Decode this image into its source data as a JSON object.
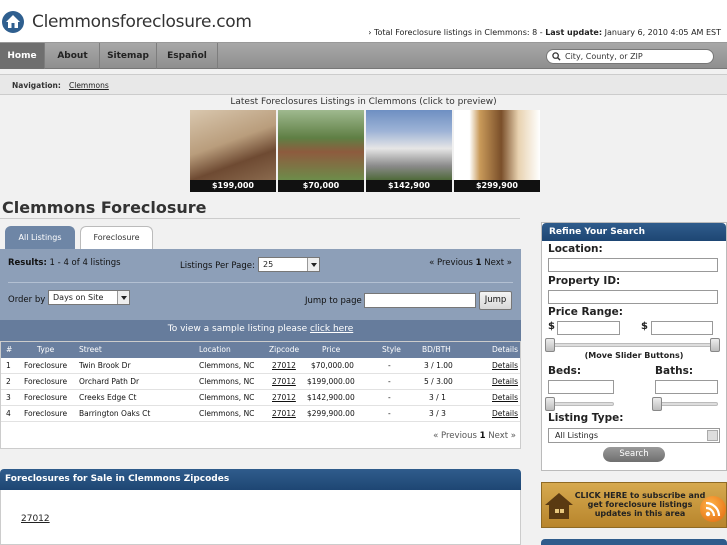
{
  "header": {
    "site_title": "Clemmonsforeclosure.com",
    "status_prefix": "› Total Foreclosure listings in Clemmons: 8 - ",
    "update_label": "Last update:",
    "update_value": " January 6, 2010 4:05 AM EST"
  },
  "nav": {
    "items": [
      {
        "label": "Home",
        "active": true
      },
      {
        "label": "About"
      },
      {
        "label": "Sitemap"
      },
      {
        "label": "Español"
      }
    ],
    "search_placeholder": "City, County, or ZIP"
  },
  "breadcrumb": {
    "label": "Navigation:",
    "link": "Clemmons"
  },
  "latest": {
    "title": "Latest Foreclosures Listings in Clemmons (click to preview)",
    "thumbs": [
      {
        "price": "$199,000"
      },
      {
        "price": "$70,000"
      },
      {
        "price": "$142,900"
      },
      {
        "price": "$299,900"
      }
    ]
  },
  "main": {
    "heading": "Clemmons Foreclosure",
    "tabs": [
      {
        "label": "All Listings",
        "active": true
      },
      {
        "label": "Foreclosure"
      }
    ],
    "results_label": "Results:",
    "results_value": " 1 - 4 of 4 listings",
    "lpp_label": "Listings Per Page:",
    "lpp_value": "25",
    "pager_prev": "« Previous",
    "pager_page": "1",
    "pager_next": "Next »",
    "orderby_label": "Order by",
    "orderby_value": "Days on Site",
    "jump_label": "Jump to page",
    "jump_button": "Jump",
    "sample_text": "To view a sample listing please ",
    "sample_link": "click here"
  },
  "table": {
    "headers": [
      "#",
      "Type",
      "Street",
      "Location",
      "Zipcode",
      "Price",
      "Style",
      "BD/BTH",
      "Details"
    ],
    "rows": [
      [
        "1",
        "Foreclosure",
        "Twin Brook Dr",
        "Clemmons, NC",
        "27012",
        "$70,000.00",
        "-",
        "3 / 1.00",
        "Details"
      ],
      [
        "2",
        "Foreclosure",
        "Orchard Path Dr",
        "Clemmons, NC",
        "27012",
        "$199,000.00",
        "-",
        "5 / 3.00",
        "Details"
      ],
      [
        "3",
        "Foreclosure",
        "Creeks Edge Ct",
        "Clemmons, NC",
        "27012",
        "$142,900.00",
        "-",
        "3 / 1",
        "Details"
      ],
      [
        "4",
        "Foreclosure",
        "Barrington Oaks Ct",
        "Clemmons, NC",
        "27012",
        "$299,900.00",
        "-",
        "3 / 3",
        "Details"
      ]
    ]
  },
  "zipcodes": {
    "heading": "Foreclosures for Sale in Clemmons Zipcodes",
    "items": [
      "27012"
    ]
  },
  "refine": {
    "heading": "Refine Your Search",
    "location_label": "Location:",
    "property_id_label": "Property ID:",
    "price_range_label": "Price Range:",
    "dollar": "$",
    "slider_note": "(Move Slider Buttons)",
    "beds_label": "Beds:",
    "baths_label": "Baths:",
    "listing_type_label": "Listing Type:",
    "listing_type_value": "All Listings",
    "search_button": "Search"
  },
  "subscribe": {
    "text": "CLICK HERE to subscribe and get foreclosure listings updates in this area"
  },
  "colors": {
    "accent_blue": "#1e4673",
    "panel_blue": "#8d9fb8",
    "subscribe_gold": "#d6a94f"
  }
}
